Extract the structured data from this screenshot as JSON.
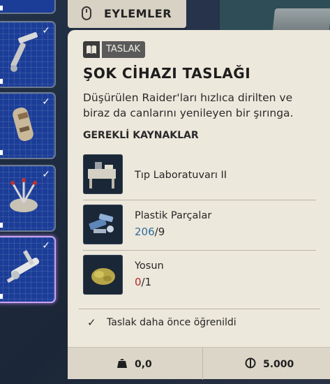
{
  "actions_tab": {
    "label": "EYLEMLER",
    "icon": "mouse-icon"
  },
  "tooltip": {
    "badge": "TASLAK",
    "badge_icon": "book-icon",
    "title": "ŞOK CİHAZI TASLAĞI",
    "description": "Düşürülen Raider'ları hızlıca dirilten ve biraz da canlarını yenileyen bir şırınga.",
    "requirements_header": "GEREKLİ KAYNAKLAR",
    "requirements": [
      {
        "name": "Tıp Laboratuvarı II",
        "icon": "medical-lab-icon",
        "have": "",
        "sep": "",
        "need": ""
      },
      {
        "name": "Plastik Parçalar",
        "icon": "plastic-parts-icon",
        "have": "206",
        "sep": "/",
        "need": "9"
      },
      {
        "name": "Yosun",
        "icon": "moss-icon",
        "have": "0",
        "sep": "/",
        "need": "1"
      }
    ],
    "learned_text": "Taslak daha önce öğrenildi",
    "footer": {
      "weight": "0,0",
      "weight_icon": "weight-icon",
      "price": "5.000",
      "price_icon": "coin-icon"
    }
  },
  "colors": {
    "card_bg": "#ede8dc",
    "have_enough": "#2f6d9b",
    "have_missing": "#b02828",
    "slot_bg": "#1b3d97"
  }
}
